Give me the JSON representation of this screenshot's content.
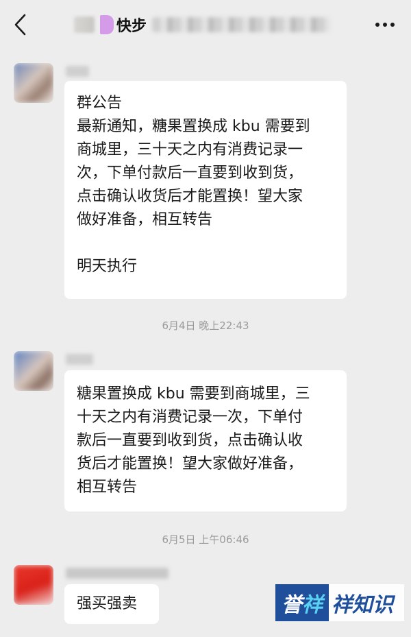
{
  "header": {
    "title": "快步",
    "back_icon": "chevron-left-icon",
    "more_icon": "ellipsis-icon"
  },
  "messages": [
    {
      "text": "群公告\n最新通知，糖果置换成 kbu 需要到\n商城里，三十天之内有消费记录一\n次，下单付款后一直要到收到货，\n点击确认收货后才能置换！望大家\n做好准备，相互转告\n\n明天执行"
    },
    {
      "text": "糖果置换成 kbu 需要到商城里，三\n十天之内有消费记录一次，下单付\n款后一直要到收到货，点击确认收\n货后才能置换！望大家做好准备，\n相互转告"
    },
    {
      "text": "强买强卖"
    }
  ],
  "timestamps": [
    "6月4日 晚上22:43",
    "6月5日 上午06:46"
  ],
  "watermark": {
    "part1": "誉",
    "part2": "祥",
    "part3": "祥知识"
  },
  "colors": {
    "background": "#ededed",
    "bubble": "#ffffff",
    "timestamp": "#9b9b9b",
    "watermark_blue": "#1f4f9a",
    "watermark_cyan": "#5bd1f2"
  }
}
